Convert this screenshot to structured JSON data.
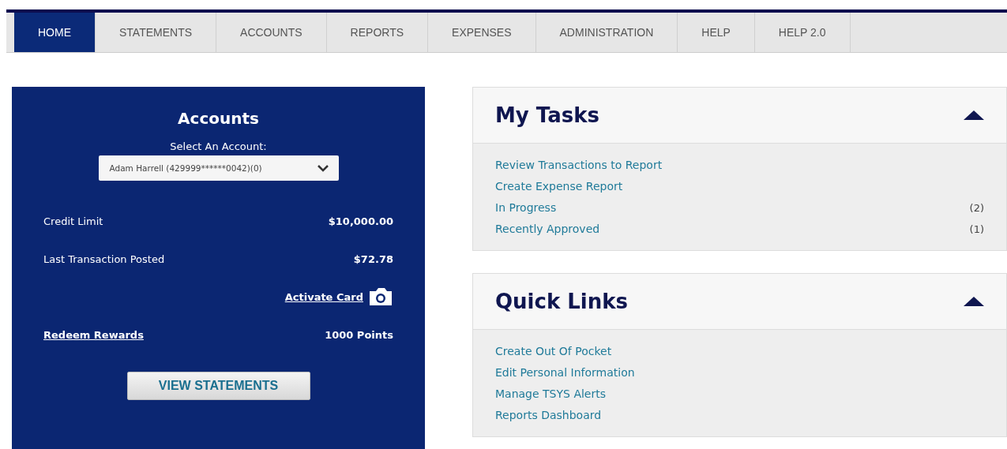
{
  "nav": {
    "tabs": [
      {
        "label": "HOME",
        "selected": true
      },
      {
        "label": "STATEMENTS",
        "selected": false
      },
      {
        "label": "ACCOUNTS",
        "selected": false
      },
      {
        "label": "REPORTS",
        "selected": false
      },
      {
        "label": "EXPENSES",
        "selected": false
      },
      {
        "label": "ADMINISTRATION",
        "selected": false
      },
      {
        "label": "HELP",
        "selected": false
      },
      {
        "label": "HELP 2.0",
        "selected": false
      }
    ]
  },
  "accounts": {
    "title": "Accounts",
    "select_label": "Select An Account:",
    "select_value": "Adam Harrell (429999******0042)(0)",
    "rows": [
      {
        "kind": "info",
        "label": "Credit Limit",
        "value": "$10,000.00"
      },
      {
        "kind": "info",
        "label": "Last Transaction Posted",
        "value": "$72.78"
      },
      {
        "kind": "action",
        "link": "Activate Card"
      },
      {
        "kind": "reward",
        "link": "Redeem Rewards",
        "value": "1000 Points"
      }
    ],
    "button": "VIEW STATEMENTS"
  },
  "panels": [
    {
      "title": "My Tasks",
      "expanded": true,
      "items": [
        {
          "label": "Review Transactions to Report"
        },
        {
          "label": "Create Expense Report"
        },
        {
          "label": "In Progress",
          "count": "(2)"
        },
        {
          "label": "Recently Approved",
          "count": "(1)"
        }
      ]
    },
    {
      "title": "Quick Links",
      "expanded": true,
      "items": [
        {
          "label": "Create Out Of Pocket"
        },
        {
          "label": "Edit Personal Information"
        },
        {
          "label": "Manage TSYS Alerts"
        },
        {
          "label": "Reports Dashboard"
        }
      ]
    }
  ]
}
